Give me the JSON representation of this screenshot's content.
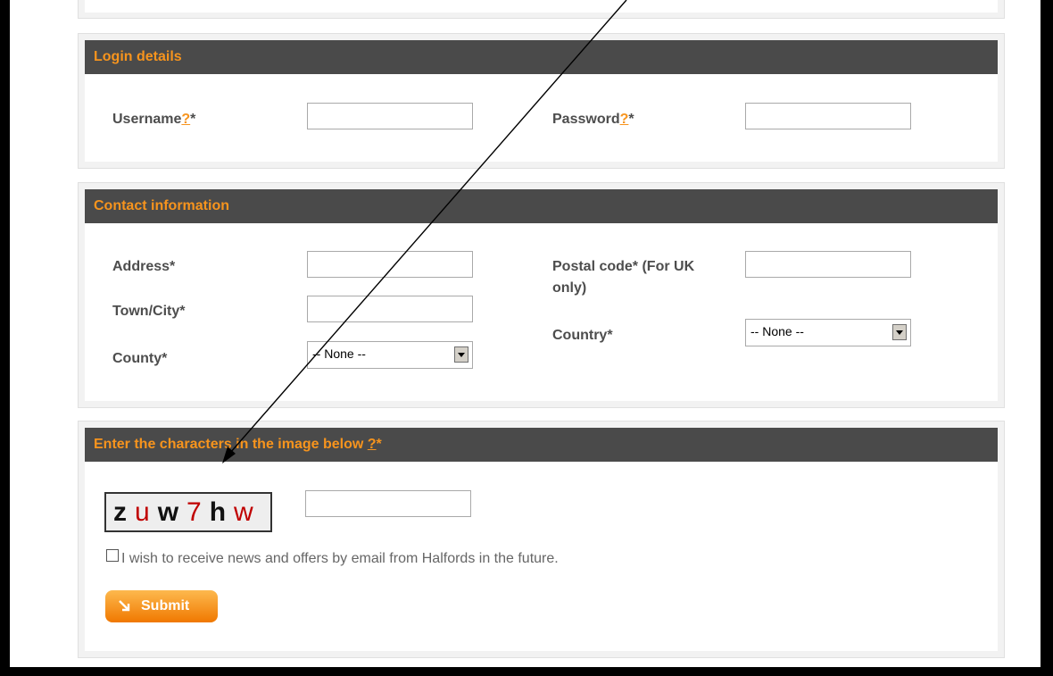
{
  "login": {
    "title": "Login details",
    "username_label": "Username",
    "username_help": "?",
    "username_req": "*",
    "username_value": "",
    "password_label": "Password",
    "password_help": "?",
    "password_req": "*",
    "password_value": ""
  },
  "contact": {
    "title": "Contact information",
    "address_label": "Address*",
    "address_value": "",
    "town_label": "Town/City*",
    "town_value": "",
    "county_label": "County*",
    "county_selected": "-- None --",
    "postal_label_line1": "Postal code* (For UK",
    "postal_label_line2": "only)",
    "postal_value": "",
    "country_label": "Country*",
    "country_selected": "-- None --"
  },
  "captcha": {
    "title": "Enter the characters in the image below",
    "help": "?",
    "req": "*",
    "chars": [
      "z",
      "u",
      "w",
      "7",
      "h",
      "w"
    ],
    "char_colors": [
      "#111111",
      "#c00000",
      "#111111",
      "#c00000",
      "#111111",
      "#c00000"
    ],
    "input_value": ""
  },
  "newsletter": {
    "checked": false,
    "label": "I wish to receive news and offers by email from Halfords in the future."
  },
  "submit": {
    "label": "Submit",
    "icon": "arrow-down-right-icon"
  },
  "colors": {
    "accent": "#f7941d",
    "header_bg": "#4a4a4a",
    "frame": "#000000"
  }
}
